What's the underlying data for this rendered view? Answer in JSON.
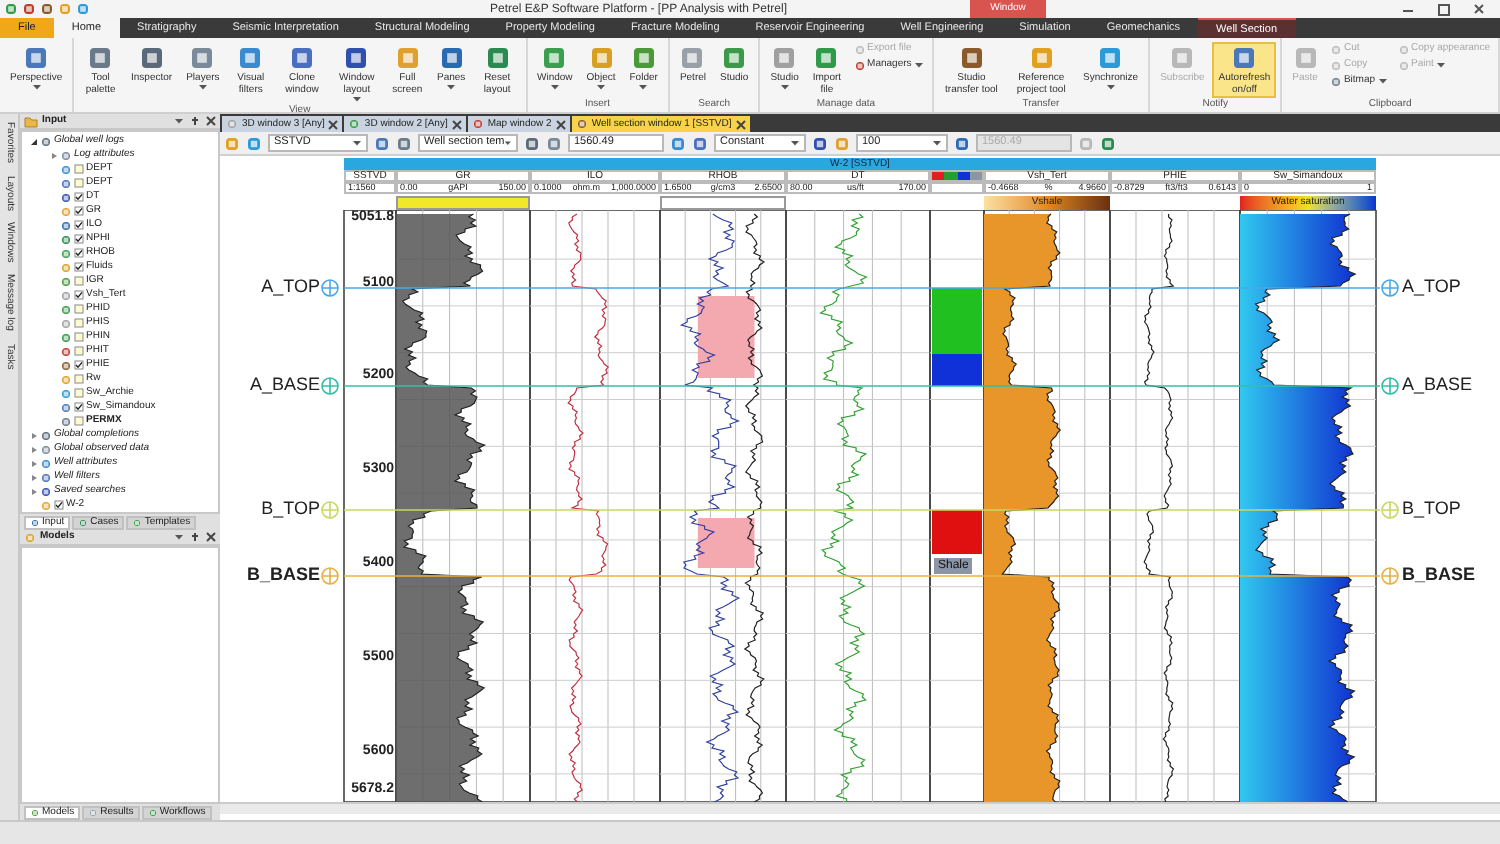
{
  "title_bar": {
    "title": "Petrel E&P Software Platform - [PP Analysis with Petrel]",
    "context_label": "Window"
  },
  "ribbon_tabs": [
    {
      "label": "File",
      "kind": "file",
      "selected": false
    },
    {
      "label": "Home",
      "kind": "tab",
      "selected": true
    },
    {
      "label": "Stratigraphy",
      "kind": "tab",
      "selected": false
    },
    {
      "label": "Seismic Interpretation",
      "kind": "tab",
      "selected": false
    },
    {
      "label": "Structural Modeling",
      "kind": "tab",
      "selected": false
    },
    {
      "label": "Property Modeling",
      "kind": "tab",
      "selected": false
    },
    {
      "label": "Fracture Modeling",
      "kind": "tab",
      "selected": false
    },
    {
      "label": "Reservoir Engineering",
      "kind": "tab",
      "selected": false
    },
    {
      "label": "Well Engineering",
      "kind": "tab",
      "selected": false
    },
    {
      "label": "Simulation",
      "kind": "tab",
      "selected": false
    },
    {
      "label": "Geomechanics",
      "kind": "tab",
      "selected": false
    },
    {
      "label": "Well Section",
      "kind": "context",
      "selected": false
    }
  ],
  "ribbon_groups": [
    {
      "items": [
        {
          "label": "Perspective",
          "kind": "large",
          "caret": true,
          "disabled": false,
          "selected": false
        }
      ]
    },
    {
      "label": "View",
      "items": [
        {
          "label": "Tool palette",
          "kind": "large",
          "caret": false,
          "disabled": false,
          "selected": false
        },
        {
          "label": "Inspector",
          "kind": "large",
          "caret": false,
          "disabled": false,
          "selected": false
        },
        {
          "label": "Players",
          "kind": "large",
          "caret": true,
          "disabled": false,
          "selected": false
        },
        {
          "label": "Visual filters",
          "kind": "large",
          "caret": false,
          "disabled": false,
          "selected": false
        },
        {
          "label": "Clone window",
          "kind": "large",
          "caret": false,
          "disabled": false,
          "selected": false
        },
        {
          "label": "Window layout",
          "kind": "large",
          "caret": true,
          "disabled": false,
          "selected": false
        },
        {
          "label": "Full screen",
          "kind": "large",
          "caret": false,
          "disabled": false,
          "selected": false
        },
        {
          "label": "Panes",
          "kind": "large",
          "caret": true,
          "disabled": false,
          "selected": false
        },
        {
          "label": "Reset layout",
          "kind": "large",
          "caret": false,
          "disabled": false,
          "selected": false
        }
      ]
    },
    {
      "label": "Insert",
      "items": [
        {
          "label": "Window",
          "kind": "large",
          "caret": true,
          "disabled": false,
          "selected": false
        },
        {
          "label": "Object",
          "kind": "large",
          "caret": true,
          "disabled": false,
          "selected": false
        },
        {
          "label": "Folder",
          "kind": "large",
          "caret": true,
          "disabled": false,
          "selected": false
        }
      ]
    },
    {
      "label": "Search",
      "items": [
        {
          "label": "Petrel",
          "kind": "large",
          "caret": false,
          "disabled": false,
          "selected": false
        },
        {
          "label": "Studio",
          "kind": "large",
          "caret": false,
          "disabled": false,
          "selected": false
        }
      ]
    },
    {
      "label": "Manage data",
      "items": [
        {
          "label": "Studio",
          "kind": "large",
          "caret": true,
          "disabled": false,
          "selected": false
        },
        {
          "label": "Import file",
          "kind": "large",
          "caret": false,
          "disabled": false,
          "selected": false
        },
        {
          "label": "Export file",
          "kind": "small",
          "caret": false,
          "disabled": true,
          "selected": false
        },
        {
          "label": "Managers",
          "kind": "small",
          "caret": true,
          "disabled": false,
          "selected": false
        }
      ]
    },
    {
      "label": "Transfer",
      "items": [
        {
          "label": "Studio transfer tool",
          "kind": "large",
          "caret": false,
          "disabled": false,
          "selected": false
        },
        {
          "label": "Reference project tool",
          "kind": "large",
          "caret": false,
          "disabled": false,
          "selected": false
        },
        {
          "label": "Synchronize",
          "kind": "large",
          "caret": true,
          "disabled": false,
          "selected": false
        }
      ]
    },
    {
      "label": "Notify",
      "items": [
        {
          "label": "Subscribe",
          "kind": "large",
          "caret": false,
          "disabled": true,
          "selected": false
        },
        {
          "label": "Autorefresh on/off",
          "kind": "large",
          "caret": false,
          "disabled": false,
          "selected": true
        }
      ]
    },
    {
      "label": "Clipboard",
      "items": [
        {
          "label": "Paste",
          "kind": "large",
          "caret": false,
          "disabled": true,
          "selected": false
        },
        {
          "label": "Cut",
          "kind": "small",
          "caret": false,
          "disabled": true,
          "selected": false
        },
        {
          "label": "Copy",
          "kind": "small",
          "caret": false,
          "disabled": true,
          "selected": false
        },
        {
          "label": "Bitmap",
          "kind": "small",
          "caret": true,
          "disabled": false,
          "selected": false
        },
        {
          "label": "Copy appearance",
          "kind": "small",
          "caret": false,
          "disabled": true,
          "selected": false
        },
        {
          "label": "Paint",
          "kind": "small",
          "caret": true,
          "disabled": true,
          "selected": false
        }
      ]
    }
  ],
  "side_strip": [
    "Favorites",
    "Layouts",
    "Windows",
    "Message log",
    "Tasks"
  ],
  "input_panel": {
    "title": "Input",
    "tree": [
      {
        "label": "Global well logs",
        "kind": "folder",
        "expanded": true,
        "children": [
          {
            "label": "Log attributes",
            "kind": "folder",
            "expanded": false
          },
          {
            "label": "DEPT",
            "kind": "log",
            "checked": false
          },
          {
            "label": "DEPT",
            "kind": "log",
            "checked": false
          },
          {
            "label": "DT",
            "kind": "log",
            "checked": true
          },
          {
            "label": "GR",
            "kind": "log",
            "checked": true
          },
          {
            "label": "ILO",
            "kind": "log",
            "checked": true
          },
          {
            "label": "NPHI",
            "kind": "log",
            "checked": true
          },
          {
            "label": "RHOB",
            "kind": "log",
            "checked": true
          },
          {
            "label": "Fluids",
            "kind": "log",
            "checked": true
          },
          {
            "label": "IGR",
            "kind": "log",
            "checked": false
          },
          {
            "label": "Vsh_Tert",
            "kind": "log",
            "checked": true
          },
          {
            "label": "PHID",
            "kind": "log",
            "checked": false
          },
          {
            "label": "PHIS",
            "kind": "log",
            "checked": false
          },
          {
            "label": "PHIN",
            "kind": "log",
            "checked": false
          },
          {
            "label": "PHIT",
            "kind": "log",
            "checked": false
          },
          {
            "label": "PHIE",
            "kind": "log",
            "checked": true
          },
          {
            "label": "Rw",
            "kind": "log",
            "checked": false
          },
          {
            "label": "Sw_Archie",
            "kind": "log",
            "checked": false
          },
          {
            "label": "Sw_Simandoux",
            "kind": "log",
            "checked": true
          },
          {
            "label": "PERMX",
            "kind": "log",
            "checked": false,
            "bold": true
          }
        ]
      },
      {
        "label": "Global completions",
        "kind": "folder",
        "expanded": false
      },
      {
        "label": "Global observed data",
        "kind": "folder",
        "expanded": false
      },
      {
        "label": "Well attributes",
        "kind": "folder",
        "expanded": false
      },
      {
        "label": "Well filters",
        "kind": "folder",
        "expanded": false
      },
      {
        "label": "Saved searches",
        "kind": "folder",
        "expanded": false
      },
      {
        "label": "W-2",
        "kind": "log",
        "checked": true
      }
    ],
    "tabs": [
      {
        "label": "Input",
        "selected": true
      },
      {
        "label": "Cases",
        "selected": false
      },
      {
        "label": "Templates",
        "selected": false
      }
    ]
  },
  "models_panel": {
    "title": "Models",
    "tabs": [
      {
        "label": "Models",
        "selected": true
      },
      {
        "label": "Results",
        "selected": false
      },
      {
        "label": "Workflows",
        "selected": false
      }
    ]
  },
  "document_tabs": [
    {
      "label": "3D window 3 [Any]",
      "selected": false
    },
    {
      "label": "3D window 2 [Any]",
      "selected": false
    },
    {
      "label": "Map window 2",
      "selected": false
    },
    {
      "label": "Well section window 1 [SSTVD]",
      "selected": true
    }
  ],
  "toolbar_fields": [
    {
      "kind": "combo",
      "value": "SSTVD",
      "disabled": false
    },
    {
      "kind": "combo",
      "value": "Well section tem",
      "disabled": false
    },
    {
      "kind": "field",
      "value": "1560.49",
      "disabled": false
    },
    {
      "kind": "combo",
      "value": "Constant",
      "disabled": false
    },
    {
      "kind": "combo",
      "value": "100",
      "disabled": false
    },
    {
      "kind": "field",
      "value": "1560.49",
      "disabled": true
    }
  ],
  "well_section": {
    "title": "W-2 [SSTVD]",
    "tracks": [
      {
        "kind": "depth",
        "name": "SSTVD",
        "min": "1:1560"
      },
      {
        "kind": "curve",
        "name": "GR",
        "min": "0.00",
        "unit": "gAPI",
        "max": "150.00",
        "band": {
          "kind": "yellow"
        }
      },
      {
        "kind": "curve",
        "name": "ILO",
        "min": "0.1000",
        "unit": "ohm.m",
        "max": "1,000.0000"
      },
      {
        "kind": "curve",
        "name": "RHOB",
        "min": "1.6500",
        "unit": "g/cm3",
        "max": "2.6500",
        "band": {
          "kind": "outline"
        }
      },
      {
        "kind": "curve",
        "name": "DT",
        "min": "80.00",
        "unit": "us/ft",
        "max": "170.00"
      },
      {
        "kind": "facies",
        "legend": [
          {
            "color": "#e02020"
          },
          {
            "color": "#20a030"
          },
          {
            "color": "#1030d8"
          },
          {
            "color": "#8a96a6"
          }
        ]
      },
      {
        "kind": "curve",
        "name": "Vsh_Tert",
        "min": "-0.4668",
        "unit": "%",
        "max": "4.9660",
        "band": {
          "kind": "vshale",
          "label": "Vshale"
        }
      },
      {
        "kind": "curve",
        "name": "PHIE",
        "min": "-0.8729",
        "unit": "ft3/ft3",
        "max": "0.6143"
      },
      {
        "kind": "curve",
        "name": "Sw_Simandoux",
        "min": "0",
        "max": "1",
        "band": {
          "kind": "saturation",
          "label": "Water saturation"
        }
      }
    ],
    "depth_labels": [
      "5051.8",
      "5100",
      "5200",
      "5300",
      "5400",
      "5500",
      "5600",
      "5678.2"
    ],
    "markers": [
      {
        "left": "A_TOP",
        "right": "A_TOP",
        "color": "#4aa8e8",
        "bold": false
      },
      {
        "left": "A_BASE",
        "right": "A_BASE",
        "color": "#30c0a8",
        "bold": false
      },
      {
        "left": "B_TOP",
        "right": "B_TOP",
        "color": "#c8d860",
        "bold": false
      },
      {
        "left": "B_BASE",
        "right": "B_BASE",
        "color": "#e8b040",
        "bold": true
      }
    ],
    "facies_blocks": [
      {
        "color": "#20c020"
      },
      {
        "color": "#1030d8"
      },
      {
        "color": "#e01010"
      }
    ],
    "facies_label": "Shale"
  }
}
